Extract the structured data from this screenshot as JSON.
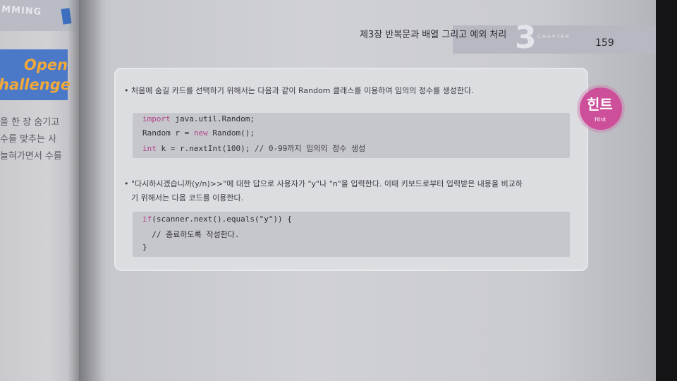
{
  "left_page": {
    "header_fragment": "MMING",
    "banner_line1": "Open",
    "banner_line2": "hallenge",
    "text_lines": [
      "을 한 장 숨기고",
      "수를 맞추는 사",
      "늘혀가면서 수를"
    ]
  },
  "header": {
    "chapter_title": "제3장  반복문과 배열 그리고 예외 처리",
    "chapter_number": "3",
    "chapter_label": "CHAPTER",
    "page_number": "159"
  },
  "hint_badge": {
    "label": "힌트",
    "sublabel": "Hint"
  },
  "hint": {
    "bullet1": "• 처음에 숨길 카드를 선택하기 위해서는 다음과 같이 Random 클래스를 이용하여 임의의 정수를 생성한다.",
    "code1": {
      "line1_kw": "import",
      "line1_rest": " java.util.Random;",
      "line2_pre": "Random r = ",
      "line2_kw": "new",
      "line2_post": " Random();",
      "line3_kw": "int",
      "line3_rest": " k = r.nextInt(100); ",
      "line3_comment": "// 0-99까지 임의의 정수 생성"
    },
    "bullet2_line1": "• \"다시하시겠습니까(y/n)>>\"에 대한 답으로 사용자가 \"y\"나 \"n\"을 입력한다. 이때 키보드로부터 입력받은 내용을 비교하",
    "bullet2_line2": "기 위해서는 다음 코드를 이용한다.",
    "code2": {
      "line1_kw": "if",
      "line1_rest": "(scanner.next().equals(\"y\")) {",
      "line2": "  // 종료하도록 작성한다.",
      "line3": "}"
    }
  }
}
